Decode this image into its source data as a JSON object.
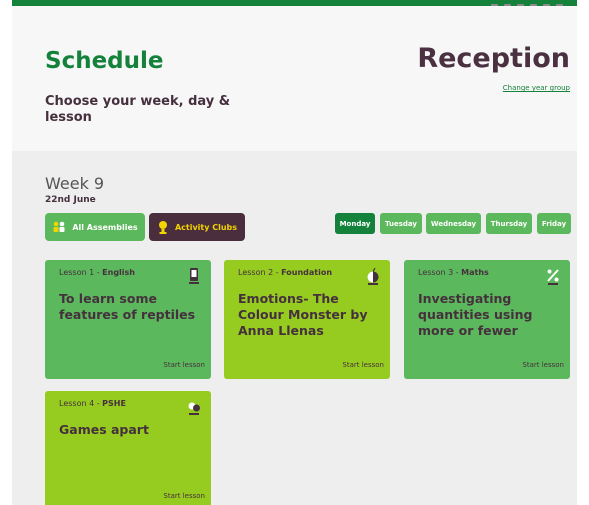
{
  "header": {
    "title": "Schedule",
    "subtitle": "Choose your week, day & lesson",
    "year_group": "Reception",
    "change_link": "Change year group"
  },
  "week": {
    "label": "Week 9",
    "date": "22nd June"
  },
  "filters": {
    "assemblies": "All Assemblies",
    "clubs": "Activity Clubs"
  },
  "days": [
    "Monday",
    "Tuesday",
    "Wednesday",
    "Thursday",
    "Friday"
  ],
  "selected_day": "Monday",
  "lessons": [
    {
      "number": "Lesson 1",
      "subject": "English",
      "title": "To learn some features of reptiles",
      "action": "Start lesson",
      "icon": "phone-icon",
      "color": "#5cb85c"
    },
    {
      "number": "Lesson 2",
      "subject": "Foundation",
      "title": "Emotions- The Colour Monster by Anna Llenas",
      "action": "Start lesson",
      "icon": "bomb-icon",
      "color": "#96cc1f"
    },
    {
      "number": "Lesson 3",
      "subject": "Maths",
      "title": "Investigating quantities using more or fewer",
      "action": "Start lesson",
      "icon": "percent-icon",
      "color": "#5cb85c"
    },
    {
      "number": "Lesson 4",
      "subject": "PSHE",
      "title": "Games apart",
      "action": "Start lesson",
      "icon": "balls-icon",
      "color": "#96cc1f"
    }
  ],
  "colors": {
    "brand_green": "#14823a",
    "card_green": "#5cb85c",
    "card_lime": "#96cc1f",
    "dark_plum": "#45303d",
    "club_yellow": "#f2d400"
  }
}
